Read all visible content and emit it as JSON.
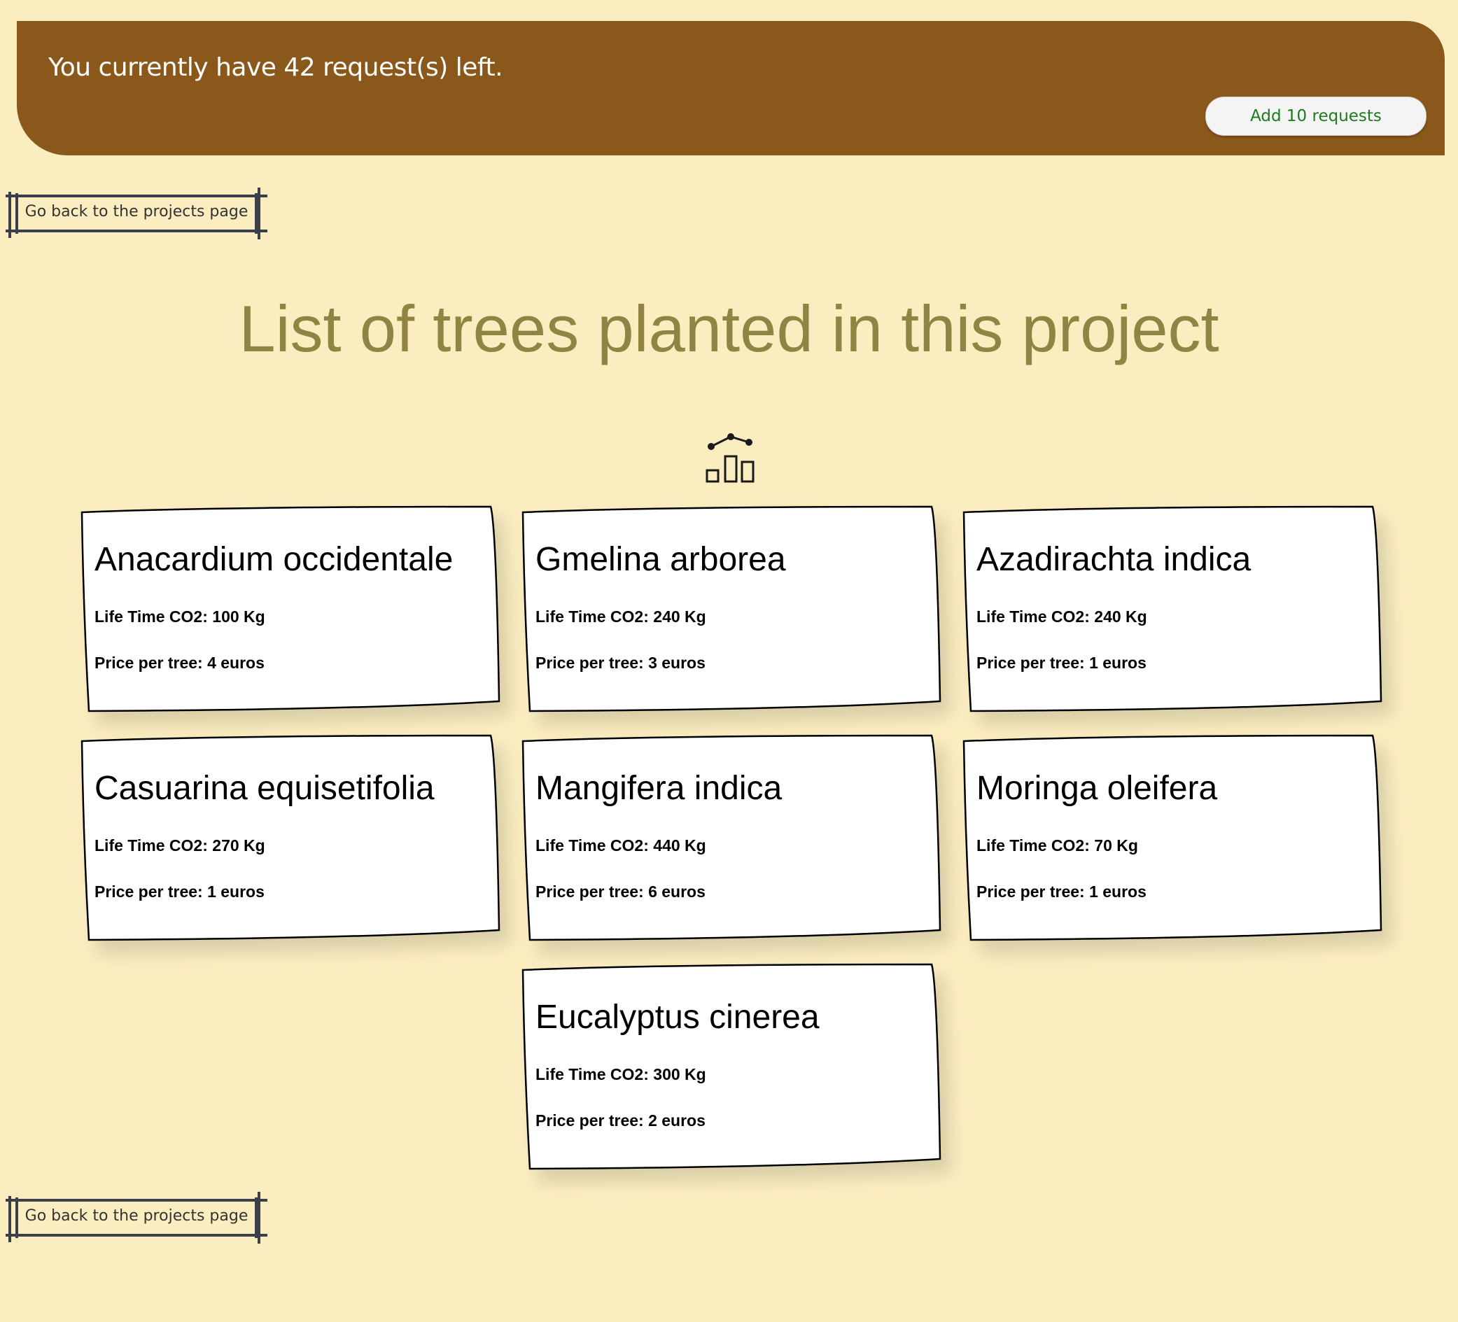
{
  "banner": {
    "message": "You currently have 42 request(s) left.",
    "add_button_label": "Add 10 requests"
  },
  "navigation": {
    "back_label_top": "Go back to the projects page",
    "back_label_bottom": "Go back to the projects page"
  },
  "page": {
    "title": "List of trees planted in this project"
  },
  "icons": {
    "stats": "stats-chart-icon"
  },
  "colors": {
    "background": "#faedc0",
    "banner": "#8b581c",
    "title": "#8e8542",
    "button_text": "#1e7a1e"
  },
  "trees": [
    {
      "name": "Anacardium occidentale",
      "co2": "Life Time CO2: 100 Kg",
      "price": "Price per tree: 4 euros"
    },
    {
      "name": "Gmelina arborea",
      "co2": "Life Time CO2: 240 Kg",
      "price": "Price per tree: 3 euros"
    },
    {
      "name": "Azadirachta indica",
      "co2": "Life Time CO2: 240 Kg",
      "price": "Price per tree: 1 euros"
    },
    {
      "name": "Casuarina equisetifolia",
      "co2": "Life Time CO2: 270 Kg",
      "price": "Price per tree: 1 euros"
    },
    {
      "name": "Mangifera indica",
      "co2": "Life Time CO2: 440 Kg",
      "price": "Price per tree: 6 euros"
    },
    {
      "name": "Moringa oleifera",
      "co2": "Life Time CO2: 70 Kg",
      "price": "Price per tree: 1 euros"
    },
    {
      "name": "Eucalyptus cinerea",
      "co2": "Life Time CO2: 300 Kg",
      "price": "Price per tree: 2 euros"
    }
  ]
}
